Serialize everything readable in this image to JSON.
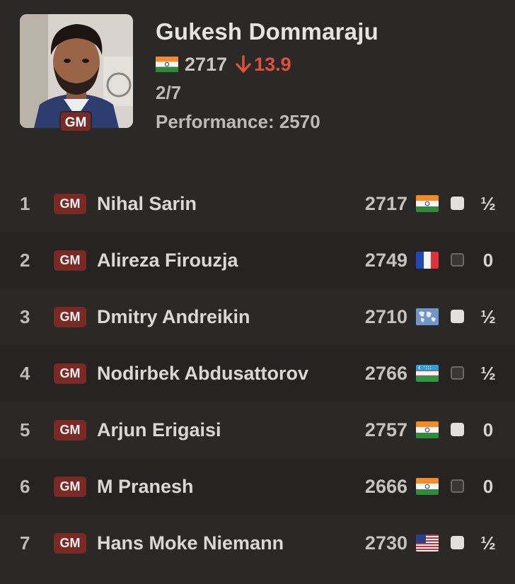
{
  "player": {
    "name": "Gukesh Dommaraju",
    "title": "GM",
    "country": "India",
    "rating": "2717",
    "rating_change": "13.9",
    "rating_change_direction": "down",
    "score": "2/7",
    "performance": "Performance: 2570"
  },
  "colors": {
    "background": "#2b2926",
    "alt_row": "#262422",
    "title_badge": "#7a2a24",
    "negative_change": "#e2503f"
  },
  "opponents": [
    {
      "rank": "1",
      "title": "GM",
      "name": "Nihal Sarin",
      "rating": "2717",
      "flag": "india-flag",
      "color": "white",
      "result": "½"
    },
    {
      "rank": "2",
      "title": "GM",
      "name": "Alireza Firouzja",
      "rating": "2749",
      "flag": "france-flag",
      "color": "black",
      "result": "0"
    },
    {
      "rank": "3",
      "title": "GM",
      "name": "Dmitry Andreikin",
      "rating": "2710",
      "flag": "world-flag",
      "color": "white",
      "result": "½"
    },
    {
      "rank": "4",
      "title": "GM",
      "name": "Nodirbek Abdusattorov",
      "rating": "2766",
      "flag": "uzbekistan-flag",
      "color": "black",
      "result": "½"
    },
    {
      "rank": "5",
      "title": "GM",
      "name": "Arjun Erigaisi",
      "rating": "2757",
      "flag": "india-flag",
      "color": "white",
      "result": "0"
    },
    {
      "rank": "6",
      "title": "GM",
      "name": "M Pranesh",
      "rating": "2666",
      "flag": "india-flag",
      "color": "black",
      "result": "0"
    },
    {
      "rank": "7",
      "title": "GM",
      "name": "Hans Moke Niemann",
      "rating": "2730",
      "flag": "usa-flag",
      "color": "white",
      "result": "½"
    }
  ]
}
